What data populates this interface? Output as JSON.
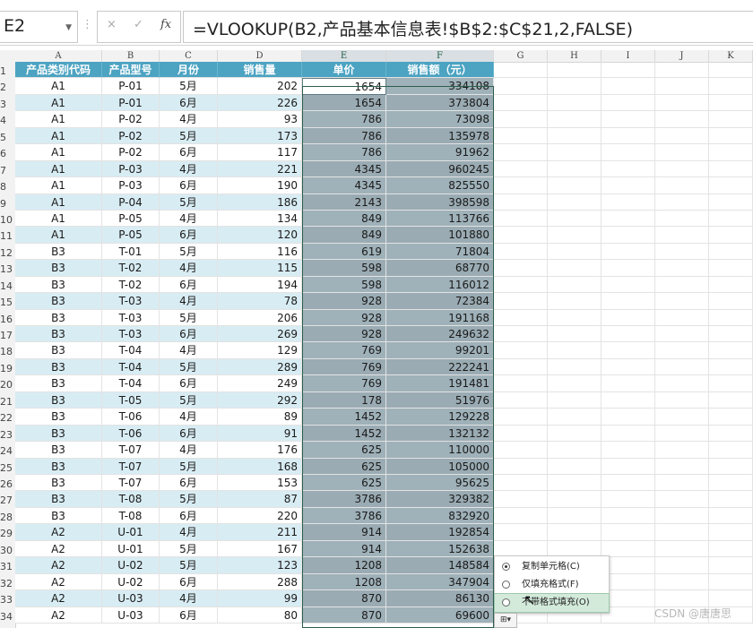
{
  "formula_bar": {
    "name_box": "E2",
    "cancel_icon": "×",
    "confirm_icon": "✓",
    "fx_icon": "fx",
    "formula": "=VLOOKUP(B2,产品基本信息表!$B$2:$C$21,2,FALSE)"
  },
  "columns": [
    "A",
    "B",
    "C",
    "D",
    "E",
    "F",
    "G",
    "H",
    "I",
    "J",
    "K"
  ],
  "selected_columns": [
    "E",
    "F"
  ],
  "table": {
    "headers": [
      "产品类别代码",
      "产品型号",
      "月份",
      "销售量",
      "单价",
      "销售额（元）"
    ],
    "rows": [
      [
        "A1",
        "P-01",
        "5月",
        "202",
        "1654",
        "334108"
      ],
      [
        "A1",
        "P-01",
        "6月",
        "226",
        "1654",
        "373804"
      ],
      [
        "A1",
        "P-02",
        "4月",
        "93",
        "786",
        "73098"
      ],
      [
        "A1",
        "P-02",
        "5月",
        "173",
        "786",
        "135978"
      ],
      [
        "A1",
        "P-02",
        "6月",
        "117",
        "786",
        "91962"
      ],
      [
        "A1",
        "P-03",
        "4月",
        "221",
        "4345",
        "960245"
      ],
      [
        "A1",
        "P-03",
        "6月",
        "190",
        "4345",
        "825550"
      ],
      [
        "A1",
        "P-04",
        "5月",
        "186",
        "2143",
        "398598"
      ],
      [
        "A1",
        "P-05",
        "4月",
        "134",
        "849",
        "113766"
      ],
      [
        "A1",
        "P-05",
        "6月",
        "120",
        "849",
        "101880"
      ],
      [
        "B3",
        "T-01",
        "5月",
        "116",
        "619",
        "71804"
      ],
      [
        "B3",
        "T-02",
        "4月",
        "115",
        "598",
        "68770"
      ],
      [
        "B3",
        "T-02",
        "6月",
        "194",
        "598",
        "116012"
      ],
      [
        "B3",
        "T-03",
        "4月",
        "78",
        "928",
        "72384"
      ],
      [
        "B3",
        "T-03",
        "5月",
        "206",
        "928",
        "191168"
      ],
      [
        "B3",
        "T-03",
        "6月",
        "269",
        "928",
        "249632"
      ],
      [
        "B3",
        "T-04",
        "4月",
        "129",
        "769",
        "99201"
      ],
      [
        "B3",
        "T-04",
        "5月",
        "289",
        "769",
        "222241"
      ],
      [
        "B3",
        "T-04",
        "6月",
        "249",
        "769",
        "191481"
      ],
      [
        "B3",
        "T-05",
        "5月",
        "292",
        "178",
        "51976"
      ],
      [
        "B3",
        "T-06",
        "4月",
        "89",
        "1452",
        "129228"
      ],
      [
        "B3",
        "T-06",
        "6月",
        "91",
        "1452",
        "132132"
      ],
      [
        "B3",
        "T-07",
        "4月",
        "176",
        "625",
        "110000"
      ],
      [
        "B3",
        "T-07",
        "5月",
        "168",
        "625",
        "105000"
      ],
      [
        "B3",
        "T-07",
        "6月",
        "153",
        "625",
        "95625"
      ],
      [
        "B3",
        "T-08",
        "5月",
        "87",
        "3786",
        "329382"
      ],
      [
        "B3",
        "T-08",
        "6月",
        "220",
        "3786",
        "832920"
      ],
      [
        "A2",
        "U-01",
        "4月",
        "211",
        "914",
        "192854"
      ],
      [
        "A2",
        "U-01",
        "5月",
        "167",
        "914",
        "152638"
      ],
      [
        "A2",
        "U-02",
        "5月",
        "123",
        "1208",
        "148584"
      ],
      [
        "A2",
        "U-02",
        "6月",
        "288",
        "1208",
        "347904"
      ],
      [
        "A2",
        "U-03",
        "4月",
        "99",
        "870",
        "86130"
      ],
      [
        "A2",
        "U-03",
        "6月",
        "80",
        "870",
        "69600"
      ]
    ]
  },
  "row_numbers": [
    "1",
    "2",
    "3",
    "4",
    "5",
    "6",
    "7",
    "8",
    "9",
    "10",
    "11",
    "12",
    "13",
    "14",
    "15",
    "16",
    "17",
    "18",
    "19",
    "20",
    "21",
    "22",
    "23",
    "24",
    "25",
    "26",
    "27",
    "28",
    "29",
    "30",
    "31",
    "32",
    "33",
    "34"
  ],
  "autofill_menu": {
    "items": [
      {
        "label": "复制单元格(C)",
        "selected": true
      },
      {
        "label": "仅填充格式(F)",
        "selected": false
      },
      {
        "label": "不带格式填充(O)",
        "selected": false
      }
    ],
    "hovered_index": 2,
    "icon_label": "⊞▾"
  },
  "watermark": "CSDN @唐唐思",
  "colors": {
    "header_bg": "#4ca3c2",
    "band": "#d8ecf3",
    "selection": "#9fb1b9"
  }
}
